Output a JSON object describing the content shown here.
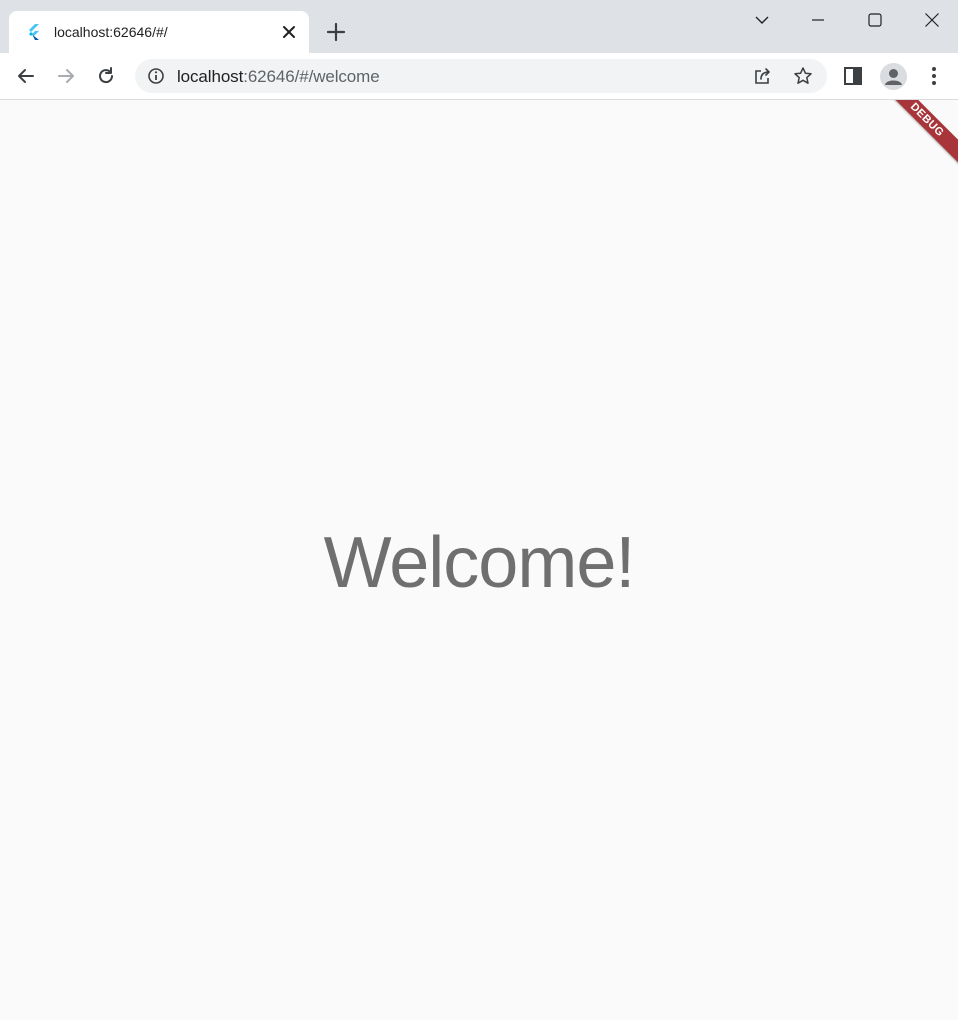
{
  "tab": {
    "title": "localhost:62646/#/",
    "favicon": "flutter-logo-icon"
  },
  "window_controls": {
    "tab_search_icon": "chevron-down-icon",
    "minimize_icon": "minimize-icon",
    "maximize_icon": "maximize-icon",
    "close_icon": "close-icon"
  },
  "toolbar": {
    "url_host": "localhost",
    "url_path": ":62646/#/welcome",
    "back_icon": "back-arrow-icon",
    "forward_icon": "forward-arrow-icon",
    "reload_icon": "reload-icon"
  },
  "content": {
    "heading": "Welcome!",
    "debug_banner": "DEBUG"
  },
  "colors": {
    "tabstrip": "#dee1e6",
    "page_background": "#fafafa",
    "heading_text": "#6f6f6f",
    "debug_banner": "#a8353a"
  }
}
